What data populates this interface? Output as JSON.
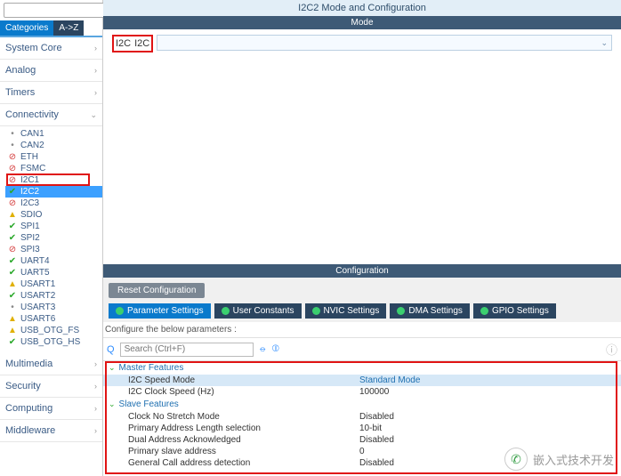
{
  "sidebar": {
    "search_placeholder": "",
    "tabs": {
      "categories": "Categories",
      "az": "A->Z"
    },
    "cats": {
      "system_core": "System Core",
      "analog": "Analog",
      "timers": "Timers",
      "connectivity": "Connectivity",
      "multimedia": "Multimedia",
      "security": "Security",
      "computing": "Computing",
      "middleware": "Middleware"
    },
    "tree": [
      {
        "label": "CAN1",
        "icon": ""
      },
      {
        "label": "CAN2",
        "icon": ""
      },
      {
        "label": "ETH",
        "icon": "red"
      },
      {
        "label": "FSMC",
        "icon": "red"
      },
      {
        "label": "I2C1",
        "icon": "red"
      },
      {
        "label": "I2C2",
        "icon": "green",
        "selected": true
      },
      {
        "label": "I2C3",
        "icon": "red"
      },
      {
        "label": "SDIO",
        "icon": "yellow"
      },
      {
        "label": "SPI1",
        "icon": "green"
      },
      {
        "label": "SPI2",
        "icon": "green"
      },
      {
        "label": "SPI3",
        "icon": "red"
      },
      {
        "label": "UART4",
        "icon": "green"
      },
      {
        "label": "UART5",
        "icon": "green"
      },
      {
        "label": "USART1",
        "icon": "yellow"
      },
      {
        "label": "USART2",
        "icon": "green"
      },
      {
        "label": "USART3",
        "icon": ""
      },
      {
        "label": "USART6",
        "icon": "yellow"
      },
      {
        "label": "USB_OTG_FS",
        "icon": "yellow"
      },
      {
        "label": "USB_OTG_HS",
        "icon": "green"
      }
    ]
  },
  "main": {
    "title": "I2C2 Mode and Configuration",
    "mode_header": "Mode",
    "mode_label": "I2C",
    "mode_value": "I2C",
    "config_header": "Configuration",
    "reset_btn": "Reset Configuration",
    "tabs": [
      "Parameter Settings",
      "User Constants",
      "NVIC Settings",
      "DMA Settings",
      "GPIO Settings"
    ],
    "configure_note": "Configure the below parameters :",
    "search_placeholder": "Search (Ctrl+F)",
    "groups": {
      "master": "Master Features",
      "slave": "Slave Features"
    },
    "params": {
      "speed_mode": {
        "name": "I2C Speed Mode",
        "value": "Standard Mode"
      },
      "clock_speed": {
        "name": "I2C Clock Speed (Hz)",
        "value": "100000"
      },
      "no_stretch": {
        "name": "Clock No Stretch Mode",
        "value": "Disabled"
      },
      "pri_addr_len": {
        "name": "Primary Address Length selection",
        "value": "10-bit"
      },
      "dual_addr": {
        "name": "Dual Address Acknowledged",
        "value": "Disabled"
      },
      "pri_slave_addr": {
        "name": "Primary slave address",
        "value": "0"
      },
      "gen_call": {
        "name": "General Call address detection",
        "value": "Disabled"
      }
    }
  },
  "watermark": "嵌入式技术开发"
}
